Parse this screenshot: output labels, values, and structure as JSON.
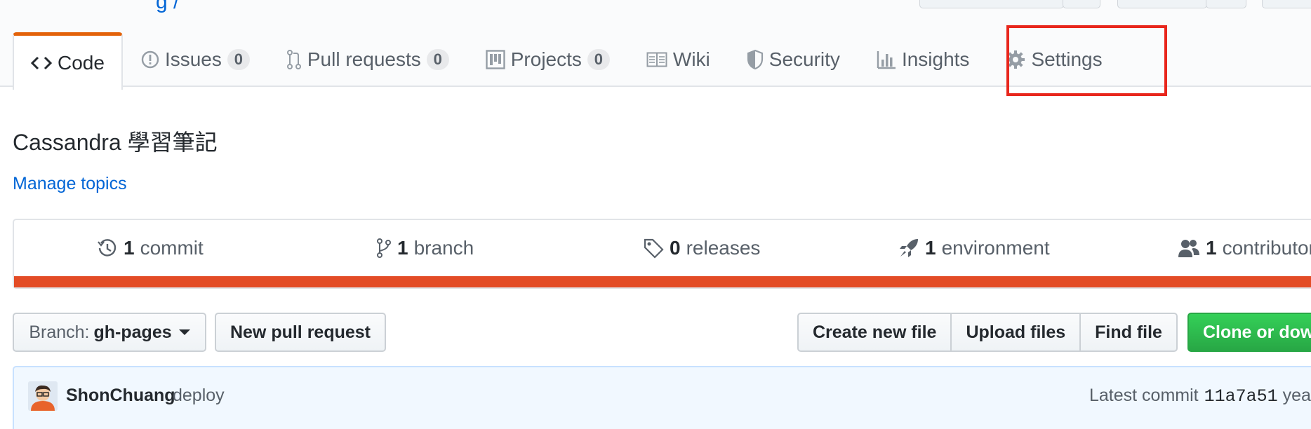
{
  "header": {
    "owner_tail": "g /"
  },
  "tabs": [
    {
      "label": "Code",
      "counter": null,
      "icon": "code-icon"
    },
    {
      "label": "Issues",
      "counter": "0",
      "icon": "issue-icon"
    },
    {
      "label": "Pull requests",
      "counter": "0",
      "icon": "pull-request-icon"
    },
    {
      "label": "Projects",
      "counter": "0",
      "icon": "project-icon"
    },
    {
      "label": "Wiki",
      "counter": null,
      "icon": "book-icon"
    },
    {
      "label": "Security",
      "counter": null,
      "icon": "shield-icon"
    },
    {
      "label": "Insights",
      "counter": null,
      "icon": "graph-icon"
    },
    {
      "label": "Settings",
      "counter": null,
      "icon": "gear-icon"
    }
  ],
  "highlight": {
    "color": "#e8261c",
    "target": "tab-settings"
  },
  "repo": {
    "description": "Cassandra 學習筆記",
    "manage_topics": "Manage topics"
  },
  "summary": {
    "commits": {
      "num": "1",
      "label": "commit"
    },
    "branches": {
      "num": "1",
      "label": "branch"
    },
    "releases": {
      "num": "0",
      "label": "releases"
    },
    "environments": {
      "num": "1",
      "label": "environment"
    },
    "contributors": {
      "num": "1",
      "label": "contributor"
    },
    "language_bar_color": "#e34c26"
  },
  "file_nav": {
    "branch_prefix": "Branch:",
    "branch_name": "gh-pages",
    "new_pull_request": "New pull request",
    "create_new_file": "Create new file",
    "upload_files": "Upload files",
    "find_file": "Find file",
    "clone_or_download": "Clone or download"
  },
  "commit": {
    "author": "ShonChuang",
    "message": "deploy",
    "latest_label": "Latest commit",
    "sha": "11a7a51",
    "time": "years ago"
  },
  "colors": {
    "accent_tab": "#e36209",
    "link": "#0366d6",
    "primary_button": "#28a745"
  }
}
